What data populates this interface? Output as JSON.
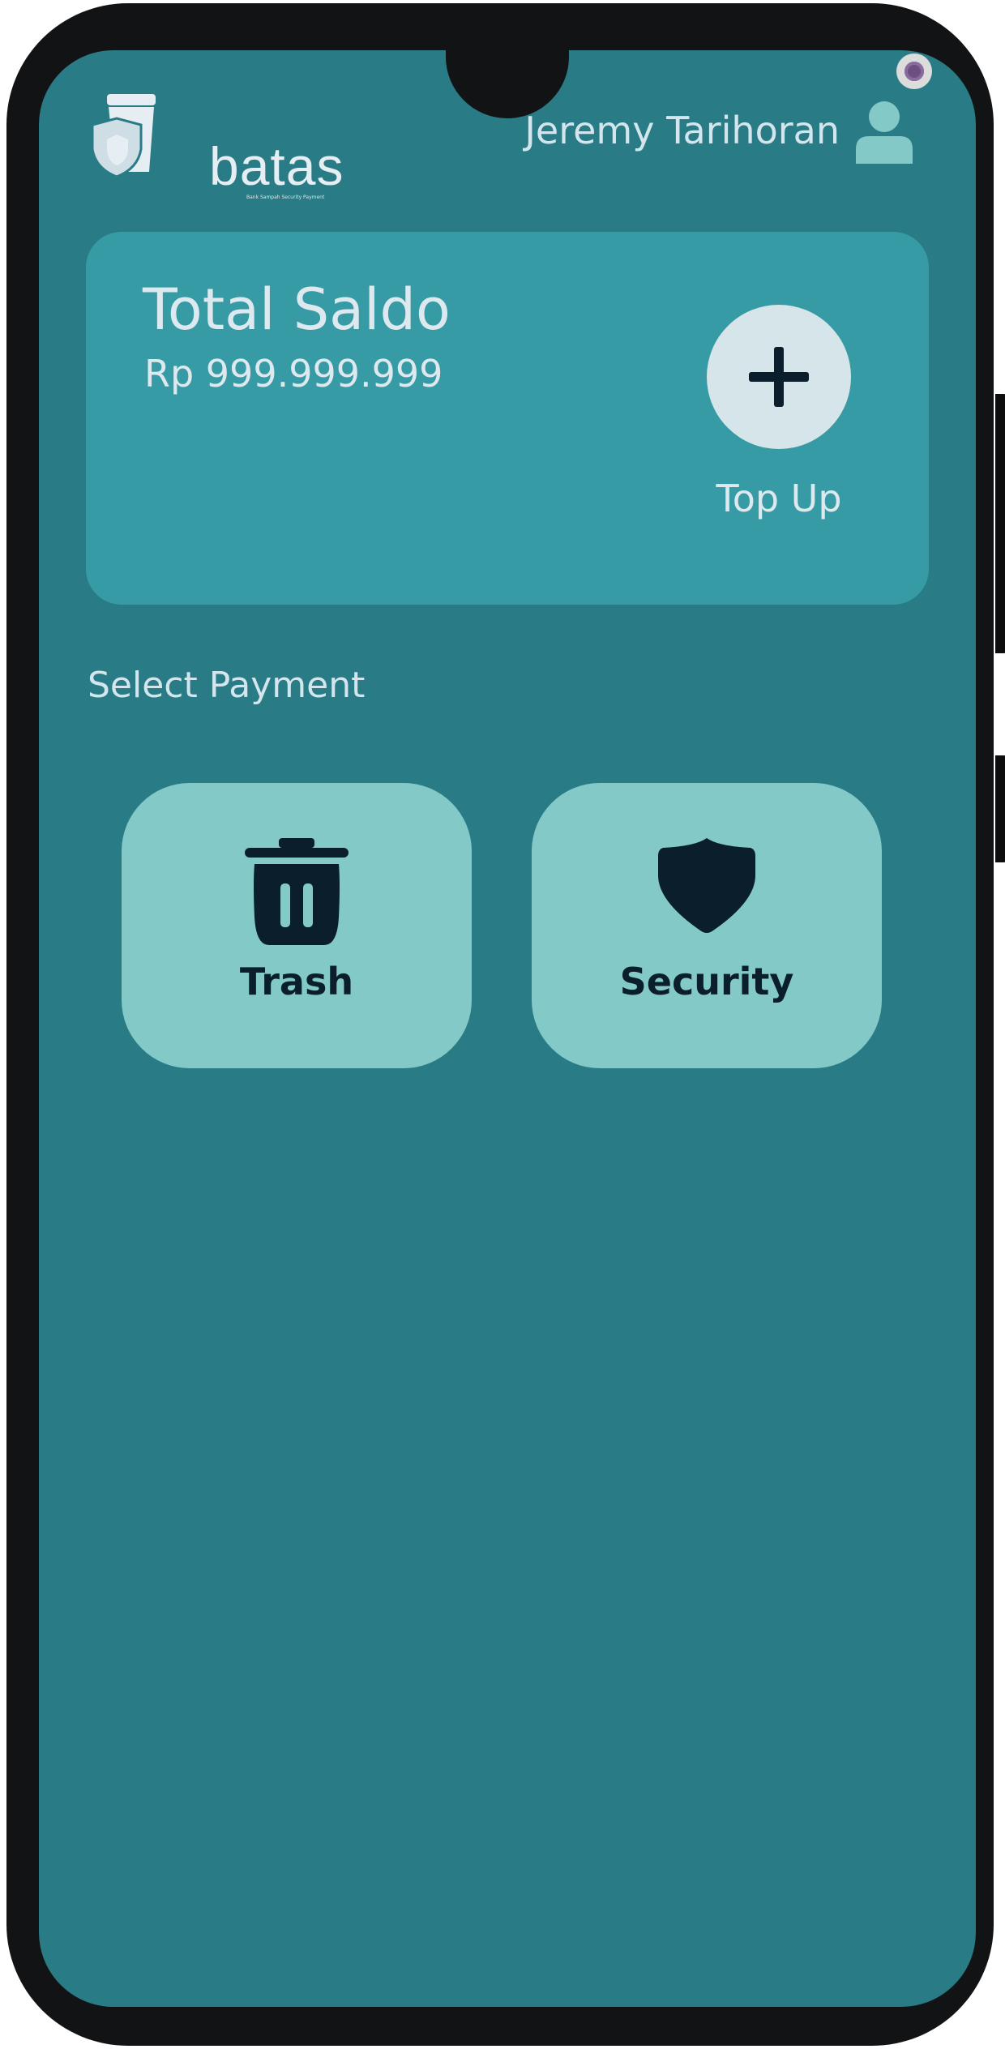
{
  "app": {
    "logo_text": "batas",
    "logo_tagline": "Bank Sampah Security Payment"
  },
  "header": {
    "user_name": "Jeremy Tarihoran",
    "user_icon": "user-icon"
  },
  "balance_card": {
    "title": "Total Saldo",
    "amount": "Rp 999.999.999",
    "topup_icon": "plus-icon",
    "topup_label": "Top Up"
  },
  "payment": {
    "section_title": "Select Payment",
    "options": [
      {
        "label": "Trash",
        "icon": "trash-icon"
      },
      {
        "label": "Security",
        "icon": "shield-icon"
      }
    ]
  },
  "colors": {
    "background": "#297b85",
    "card": "#369ba5",
    "tile": "#82c9c8",
    "text_light": "#d3e6ee",
    "text_dark": "#0a1f2b"
  }
}
